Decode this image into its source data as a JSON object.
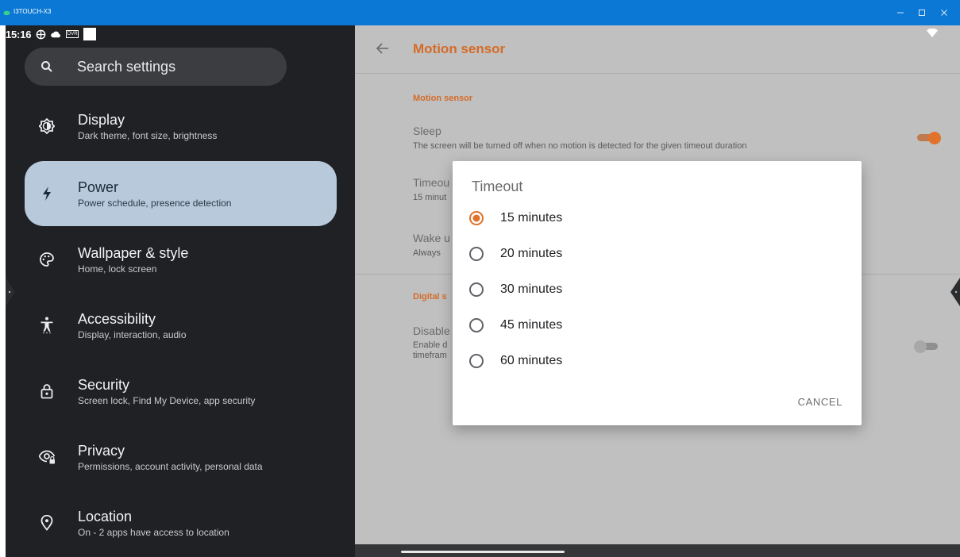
{
  "window": {
    "app_name": "I3TOUCH-X3",
    "minimize_glyph": "–",
    "maximize_glyph": "☐",
    "close_glyph": "✕"
  },
  "status_bar": {
    "time": "15:16",
    "dvr_label": "DVR"
  },
  "search": {
    "placeholder": "Search settings"
  },
  "nav": {
    "items": [
      {
        "title": "Display",
        "subtitle": "Dark theme, font size, brightness",
        "icon": "display-icon"
      },
      {
        "title": "Power",
        "subtitle": "Power schedule, presence detection",
        "icon": "power-icon",
        "selected": true
      },
      {
        "title": "Wallpaper & style",
        "subtitle": "Home, lock screen",
        "icon": "palette-icon"
      },
      {
        "title": "Accessibility",
        "subtitle": "Display, interaction, audio",
        "icon": "accessibility-icon"
      },
      {
        "title": "Security",
        "subtitle": "Screen lock, Find My Device, app security",
        "icon": "lock-icon"
      },
      {
        "title": "Privacy",
        "subtitle": "Permissions, account activity, personal data",
        "icon": "privacy-icon"
      },
      {
        "title": "Location",
        "subtitle": "On - 2 apps have access to location",
        "icon": "location-icon"
      }
    ]
  },
  "page": {
    "title": "Motion sensor",
    "section1_title": "Motion sensor",
    "sleep_title": "Sleep",
    "sleep_summary": "The screen will be turned off when no motion is detected for the given timeout duration",
    "sleep_enabled": true,
    "timeout_title": "Timeou",
    "timeout_summary": "15 minut",
    "wake_title": "Wake u",
    "wake_summary": "Always",
    "section2_title": "Digital s",
    "disable_title": "Disable",
    "disable_summary_1": "Enable d",
    "disable_summary_2": "timefram",
    "disable_enabled": false
  },
  "dialog": {
    "title": "Timeout",
    "options": [
      "15 minutes",
      "20 minutes",
      "30 minutes",
      "45 minutes",
      "60 minutes"
    ],
    "selected_index": 0,
    "cancel_label": "CANCEL"
  },
  "colors": {
    "accent": "#e0722b",
    "titlebar": "#0a78d4",
    "nav_background": "#202124",
    "nav_selected": "#b8c9dc"
  }
}
